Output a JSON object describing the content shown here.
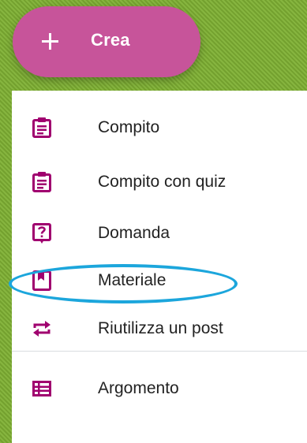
{
  "create_button": {
    "label": "Crea",
    "icon": "plus-icon",
    "color": "#c7549a"
  },
  "menu": {
    "items": [
      {
        "label": "Compito",
        "icon": "assignment-icon"
      },
      {
        "label": "Compito con quiz",
        "icon": "quiz-assignment-icon"
      },
      {
        "label": "Domanda",
        "icon": "question-icon"
      },
      {
        "label": "Materiale",
        "icon": "material-bookmark-icon"
      },
      {
        "label": "Riutilizza un post",
        "icon": "reuse-arrows-icon"
      },
      {
        "label": "Argomento",
        "icon": "topic-list-icon"
      }
    ],
    "icon_color": "#a0006f"
  },
  "annotation": {
    "highlighted_item": "Materiale",
    "color": "#1ca6dc"
  }
}
